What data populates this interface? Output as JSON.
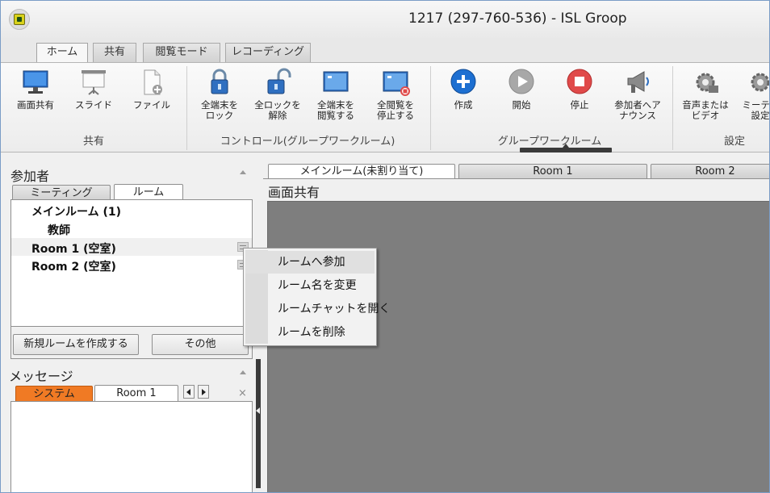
{
  "window": {
    "title": "1217 (297-760-536) - ISL Groop"
  },
  "ribbon": {
    "tabs": [
      {
        "label": "ホーム",
        "active": true
      },
      {
        "label": "共有",
        "active": false
      },
      {
        "label": "閲覧モード",
        "active": false
      },
      {
        "label": "レコーディング",
        "active": false
      }
    ],
    "buttons": {
      "screen_share": "画面共有",
      "slide": "スライド",
      "file": "ファイル",
      "lock_all_1": "全端末を",
      "lock_all_2": "ロック",
      "unlock_all_1": "全ロックを",
      "unlock_all_2": "解除",
      "view_all_1": "全端末を",
      "view_all_2": "閲覧する",
      "stop_view_1": "全閲覧を",
      "stop_view_2": "停止する",
      "create": "作成",
      "start": "開始",
      "stop": "停止",
      "announce_1": "参加者へア",
      "announce_2": "ナウンス",
      "audio_video_1": "音声または",
      "audio_video_2": "ビデオ",
      "meeting_settings_1": "ミーティ",
      "meeting_settings_2": "設定"
    },
    "groups": {
      "share": "共有",
      "control": "コントロール(グループワークルーム)",
      "groupwork": "グループワークルーム",
      "settings": "設定"
    },
    "colors": {
      "create": "#1d6fd1",
      "stop": "#e04a4a",
      "start": "#a8a8a8"
    }
  },
  "participants": {
    "title": "参加者",
    "tabs": [
      {
        "label": "ミーティング",
        "active": false
      },
      {
        "label": "ルーム",
        "active": true
      }
    ],
    "items": [
      {
        "label": "メインルーム (1)"
      },
      {
        "label": "教師"
      },
      {
        "label": "Room 1 (空室)"
      },
      {
        "label": "Room 2 (空室)"
      }
    ],
    "buttons": {
      "create_room": "新規ルームを作成する",
      "other": "その他"
    }
  },
  "messages": {
    "title": "メッセージ",
    "tabs": [
      {
        "label": "システム",
        "active": false,
        "color": "#f07a24"
      },
      {
        "label": "Room 1",
        "active": true
      }
    ],
    "close": "×"
  },
  "main": {
    "tabs": [
      {
        "label": "メインルーム(未割り当て)",
        "active": true
      },
      {
        "label": "Room 1",
        "active": false
      },
      {
        "label": "Room 2",
        "active": false
      }
    ],
    "screen_label": "画面共有"
  },
  "context_menu": {
    "items": [
      {
        "label": "ルームへ参加"
      },
      {
        "label": "ルーム名を変更"
      },
      {
        "label": "ルームチャットを開く"
      },
      {
        "label": "ルームを削除"
      }
    ]
  }
}
